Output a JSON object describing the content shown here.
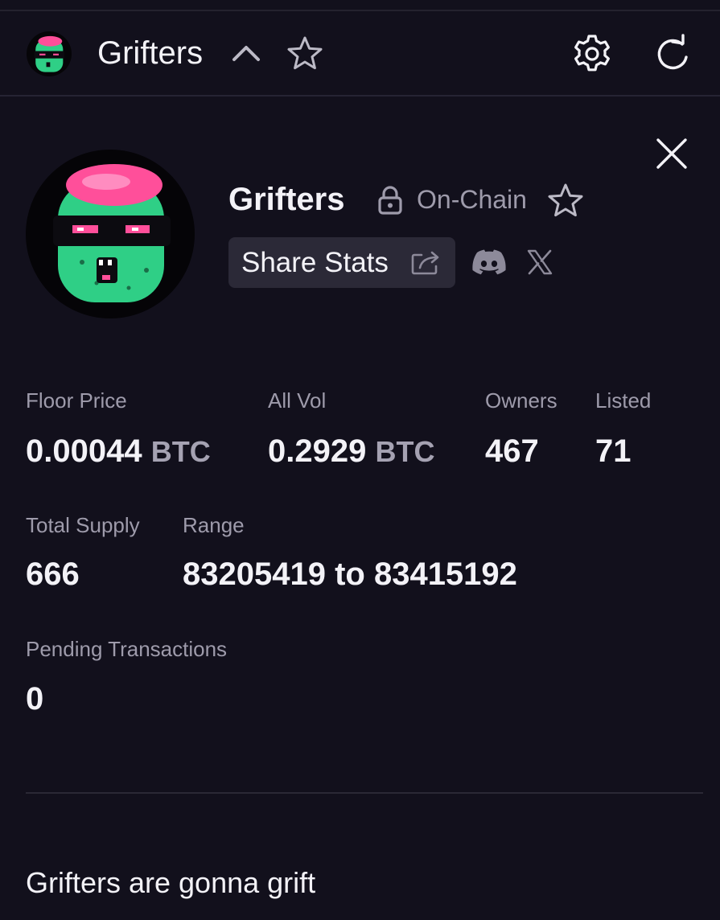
{
  "header": {
    "title": "Grifters",
    "avatar_icon": "grifter-avatar",
    "chevron_icon": "chevron-up-icon",
    "favorite_icon": "star-icon",
    "settings_icon": "gear-icon",
    "refresh_icon": "refresh-icon"
  },
  "collection": {
    "name": "Grifters",
    "badge": "On-Chain",
    "share_label": "Share Stats",
    "close_icon": "close-icon",
    "social": [
      "discord-icon",
      "x-icon"
    ]
  },
  "stats": {
    "floor_price": {
      "label": "Floor Price",
      "value": "0.00044",
      "unit": "BTC"
    },
    "all_vol": {
      "label": "All Vol",
      "value": "0.2929",
      "unit": "BTC"
    },
    "owners": {
      "label": "Owners",
      "value": "467"
    },
    "listed": {
      "label": "Listed",
      "value": "71"
    },
    "total_supply": {
      "label": "Total Supply",
      "value": "666"
    },
    "range": {
      "label": "Range",
      "value": "83205419 to 83415192"
    },
    "pending": {
      "label": "Pending Transactions",
      "value": "0"
    }
  },
  "description": "Grifters are gonna grift",
  "colors": {
    "background": "#12101c",
    "muted_text": "#9e9bab",
    "button_bg": "#2b2937",
    "avatar_face": "#2fcf86",
    "avatar_hair": "#ff4f9a"
  }
}
